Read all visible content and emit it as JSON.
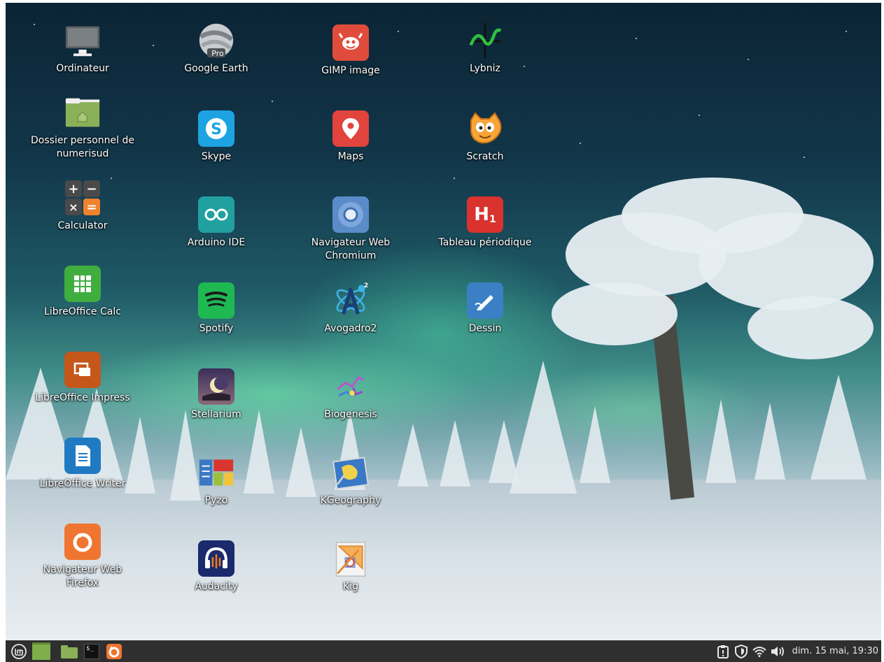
{
  "desktop": {
    "icons": [
      {
        "label": "Ordinateur",
        "icon": "computer-icon"
      },
      {
        "label": "Dossier personnel de numerisud",
        "icon": "home-folder-icon"
      },
      {
        "label": "Calculator",
        "icon": "calculator-icon"
      },
      {
        "label": "LibreOffice Calc",
        "icon": "libreoffice-calc-icon"
      },
      {
        "label": "LibreOffice Impress",
        "icon": "libreoffice-impress-icon"
      },
      {
        "label": "LibreOffice Writer",
        "icon": "libreoffice-writer-icon"
      },
      {
        "label": "Navigateur Web Firefox",
        "icon": "firefox-icon"
      },
      {
        "label": "Google Earth",
        "icon": "google-earth-icon",
        "badge": "Pro"
      },
      {
        "label": "Skype",
        "icon": "skype-icon"
      },
      {
        "label": "Arduino IDE",
        "icon": "arduino-icon"
      },
      {
        "label": "Spotify",
        "icon": "spotify-icon"
      },
      {
        "label": "Stellarium",
        "icon": "stellarium-icon"
      },
      {
        "label": "Pyzo",
        "icon": "pyzo-icon"
      },
      {
        "label": "Audacity",
        "icon": "audacity-icon"
      },
      {
        "label": "GIMP image",
        "icon": "gimp-icon"
      },
      {
        "label": "Maps",
        "icon": "maps-icon"
      },
      {
        "label": "Navigateur Web Chromium",
        "icon": "chromium-icon"
      },
      {
        "label": "Avogadro2",
        "icon": "avogadro-icon",
        "badge": "2"
      },
      {
        "label": "Biogenesis",
        "icon": "biogenesis-icon"
      },
      {
        "label": "KGeography",
        "icon": "kgeography-icon"
      },
      {
        "label": "Kig",
        "icon": "kig-icon"
      },
      {
        "label": "Lybniz",
        "icon": "lybniz-icon"
      },
      {
        "label": "Scratch",
        "icon": "scratch-icon"
      },
      {
        "label": "Tableau périodique",
        "icon": "periodic-table-icon",
        "glyph_main": "H",
        "glyph_sub": "1"
      },
      {
        "label": "Dessin",
        "icon": "drawing-icon"
      }
    ]
  },
  "taskbar": {
    "launchers": [
      "mint-menu-icon",
      "show-desktop-icon",
      "files-icon",
      "terminal-icon",
      "firefox-icon"
    ],
    "tray": [
      "clipboard-icon",
      "shield-icon",
      "wifi-icon",
      "volume-icon"
    ],
    "clock": "dim. 15 mai, 19:30"
  },
  "colors": {
    "taskbar_bg": "#2f2f2f",
    "label_text": "#ffffff"
  }
}
